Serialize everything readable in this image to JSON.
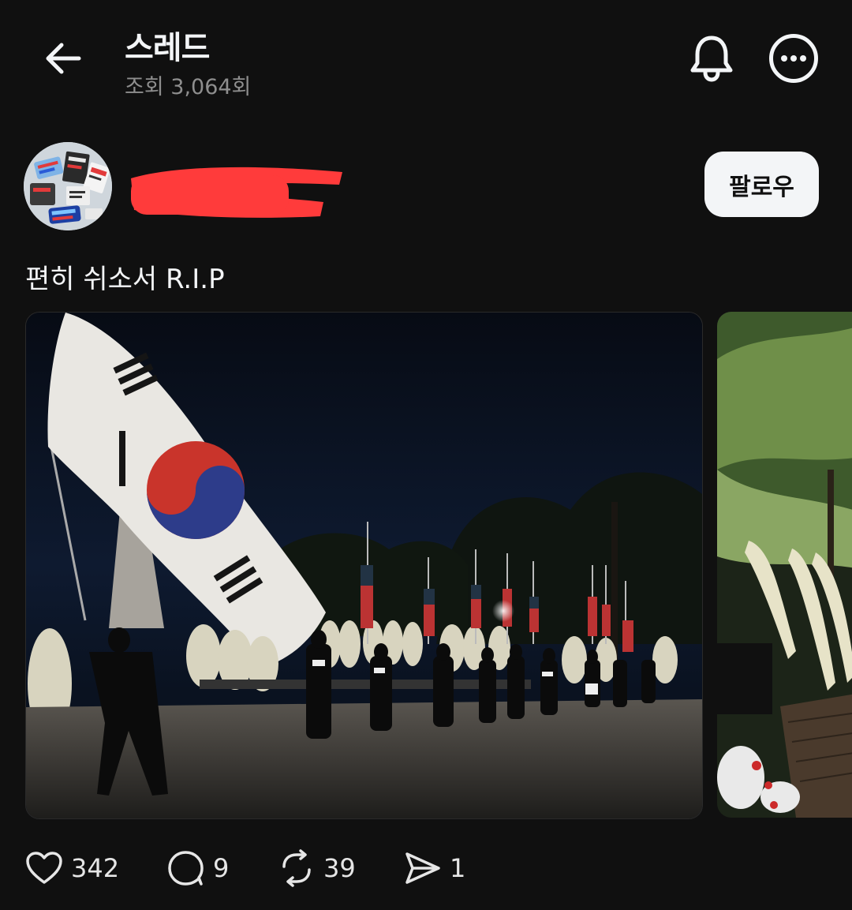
{
  "header": {
    "back_icon": "arrow-left-icon",
    "title": "스레드",
    "views": "조회 3,064회",
    "bell_icon": "bell-icon",
    "more_icon": "more-horizontal-icon"
  },
  "post": {
    "author_redacted": true,
    "follow_label": "팔로우",
    "text": "편히 쉬소서 R.I.P",
    "images": [
      "korean-flag-memorial-night-photo",
      "memorial-wreaths-photo"
    ]
  },
  "actions": {
    "likes": "342",
    "replies": "9",
    "reposts": "39",
    "shares": "1",
    "icons": [
      "heart-icon",
      "comment-icon",
      "repost-icon",
      "send-icon"
    ]
  },
  "colors": {
    "background": "#101010",
    "text": "#f3f5f7",
    "muted": "#8e8e8e",
    "redaction": "#ff3b3b"
  }
}
